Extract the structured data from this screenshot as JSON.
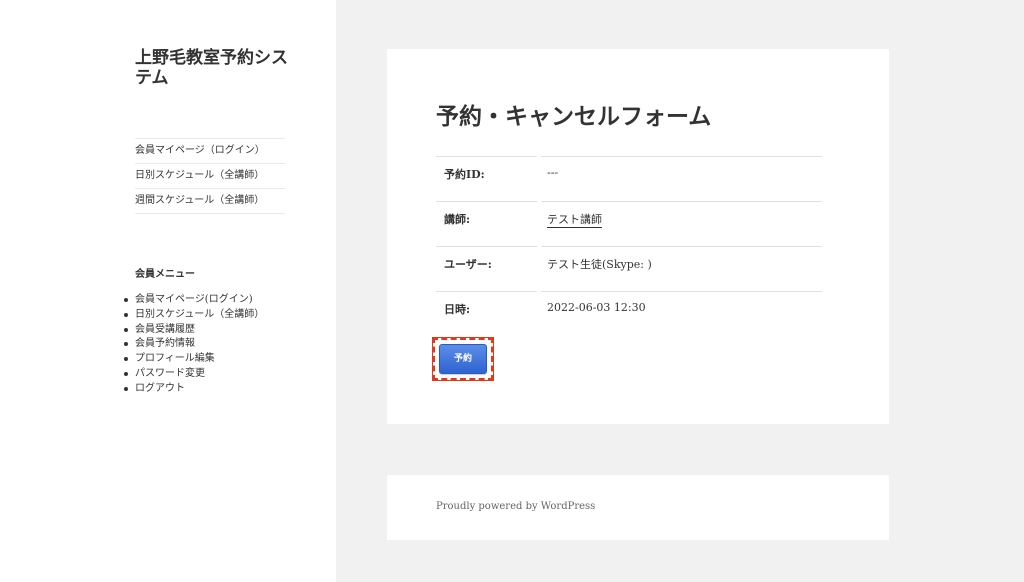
{
  "site": {
    "title": "上野毛教室予約システム"
  },
  "nav": {
    "items": [
      {
        "label": "会員マイページ（ログイン）"
      },
      {
        "label": "日別スケジュール（全講師）"
      },
      {
        "label": "週間スケジュール（全講師）"
      }
    ]
  },
  "widget": {
    "title": "会員メニュー",
    "items": [
      {
        "label": "会員マイページ(ログイン)"
      },
      {
        "label": "日別スケジュール（全講師）"
      },
      {
        "label": "会員受講履歴"
      },
      {
        "label": "会員予約情報"
      },
      {
        "label": "プロフィール編集"
      },
      {
        "label": "パスワード変更"
      },
      {
        "label": "ログアウト"
      }
    ]
  },
  "main": {
    "title": "予約・キャンセルフォーム",
    "fields": [
      {
        "label": "予約ID:",
        "value": "---"
      },
      {
        "label": "講師:",
        "value": "テスト講師"
      },
      {
        "label": "ユーザー:",
        "value": "テスト生徒(Skype: )"
      },
      {
        "label": "日時:",
        "value": "2022-06-03 12:30"
      }
    ],
    "submit_label": "予約"
  },
  "footer": {
    "text": "Proudly powered by WordPress"
  },
  "colors": {
    "accent": "#3a6fd8",
    "highlight": "#e03a1e"
  }
}
